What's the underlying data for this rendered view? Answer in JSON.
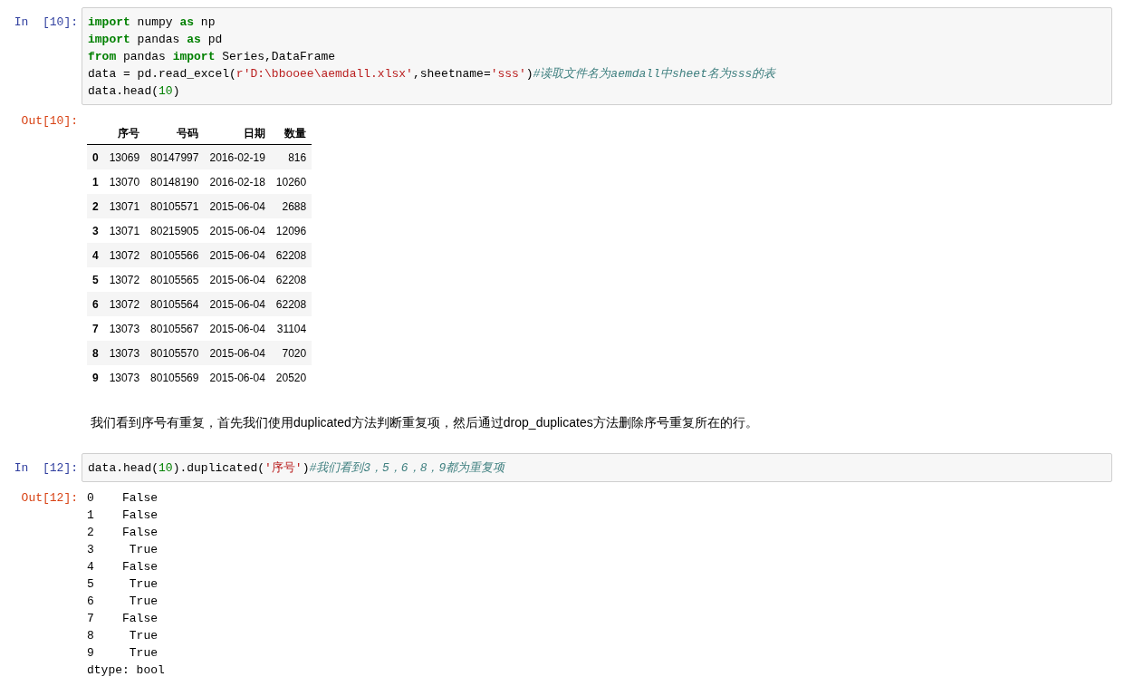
{
  "cells": [
    {
      "kind": "code",
      "prompt": "In  [10]:",
      "lines": [
        [
          {
            "kind": "keyword",
            "text": "import"
          },
          {
            "kind": "plain",
            "text": " numpy "
          },
          {
            "kind": "keyword",
            "text": "as"
          },
          {
            "kind": "plain",
            "text": " np"
          }
        ],
        [
          {
            "kind": "keyword",
            "text": "import"
          },
          {
            "kind": "plain",
            "text": " pandas "
          },
          {
            "kind": "keyword",
            "text": "as"
          },
          {
            "kind": "plain",
            "text": " pd"
          }
        ],
        [
          {
            "kind": "keyword",
            "text": "from"
          },
          {
            "kind": "plain",
            "text": " pandas "
          },
          {
            "kind": "keyword",
            "text": "import"
          },
          {
            "kind": "plain",
            "text": " Series,DataFrame"
          }
        ],
        [
          {
            "kind": "plain",
            "text": "data = pd.read_excel("
          },
          {
            "kind": "string",
            "text": "r'D:\\bbooee\\aemdall.xlsx'"
          },
          {
            "kind": "plain",
            "text": ",sheetname="
          },
          {
            "kind": "string",
            "text": "'sss'"
          },
          {
            "kind": "plain",
            "text": ")"
          },
          {
            "kind": "comment",
            "text": "#读取文件名为aemdall中sheet名为sss的表"
          }
        ],
        [
          {
            "kind": "plain",
            "text": "data.head("
          },
          {
            "kind": "number",
            "text": "10"
          },
          {
            "kind": "plain",
            "text": ")"
          }
        ]
      ]
    },
    {
      "kind": "table",
      "prompt": "Out[10]:",
      "columns": [
        "序号",
        "号码",
        "日期",
        "数量"
      ],
      "rows": [
        {
          "index": "0",
          "cells": [
            "13069",
            "80147997",
            "2016-02-19",
            "816"
          ]
        },
        {
          "index": "1",
          "cells": [
            "13070",
            "80148190",
            "2016-02-18",
            "10260"
          ]
        },
        {
          "index": "2",
          "cells": [
            "13071",
            "80105571",
            "2015-06-04",
            "2688"
          ]
        },
        {
          "index": "3",
          "cells": [
            "13071",
            "80215905",
            "2015-06-04",
            "12096"
          ]
        },
        {
          "index": "4",
          "cells": [
            "13072",
            "80105566",
            "2015-06-04",
            "62208"
          ]
        },
        {
          "index": "5",
          "cells": [
            "13072",
            "80105565",
            "2015-06-04",
            "62208"
          ]
        },
        {
          "index": "6",
          "cells": [
            "13072",
            "80105564",
            "2015-06-04",
            "62208"
          ]
        },
        {
          "index": "7",
          "cells": [
            "13073",
            "80105567",
            "2015-06-04",
            "31104"
          ]
        },
        {
          "index": "8",
          "cells": [
            "13073",
            "80105570",
            "2015-06-04",
            "7020"
          ]
        },
        {
          "index": "9",
          "cells": [
            "13073",
            "80105569",
            "2015-06-04",
            "20520"
          ]
        }
      ]
    },
    {
      "kind": "markdown",
      "text": "我们看到序号有重复，首先我们使用duplicated方法判断重复项，然后通过drop_duplicates方法删除序号重复所在的行。"
    },
    {
      "kind": "code",
      "prompt": "In  [12]:",
      "lines": [
        [
          {
            "kind": "plain",
            "text": "data.head("
          },
          {
            "kind": "number",
            "text": "10"
          },
          {
            "kind": "plain",
            "text": ").duplicated("
          },
          {
            "kind": "string",
            "text": "'序号'"
          },
          {
            "kind": "plain",
            "text": ")"
          },
          {
            "kind": "comment",
            "text": "#我们看到3，5，6，8，9都为重复项"
          }
        ]
      ]
    },
    {
      "kind": "stream",
      "prompt": "Out[12]:",
      "lines": [
        "0    False",
        "1    False",
        "2    False",
        "3     True",
        "4    False",
        "5     True",
        "6     True",
        "7    False",
        "8     True",
        "9     True",
        "dtype: bool"
      ]
    }
  ]
}
